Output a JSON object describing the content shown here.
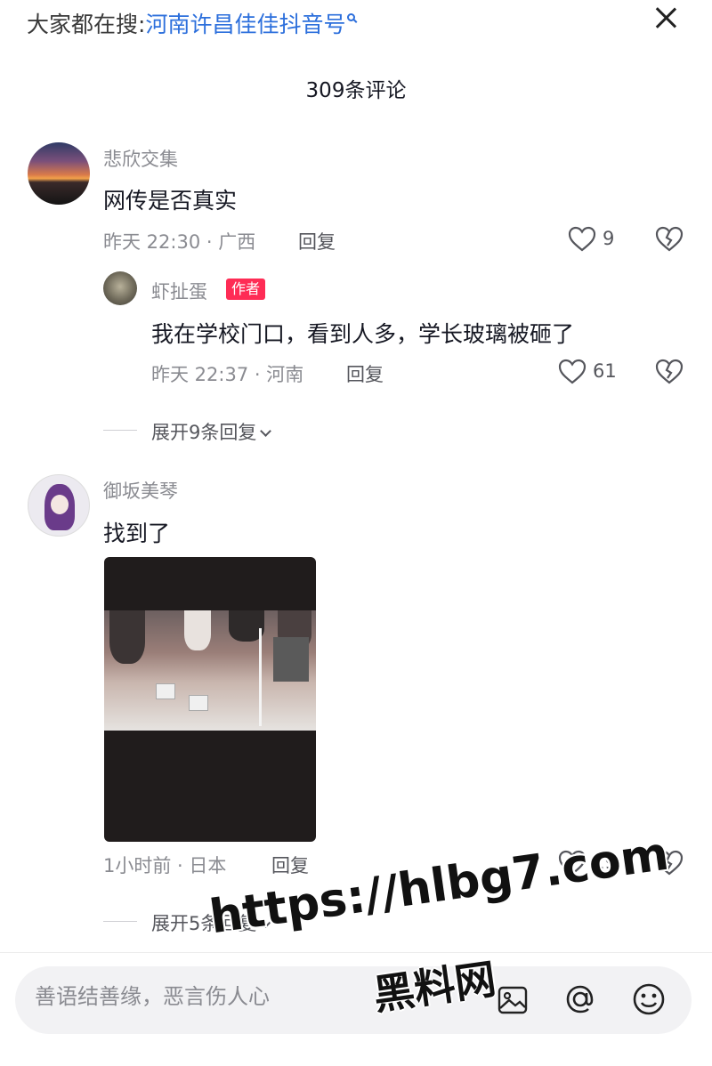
{
  "header": {
    "search_prefix": "大家都在搜:",
    "search_term": "河南许昌佳佳抖音号",
    "comment_count_title": "309条评论"
  },
  "comments": [
    {
      "username": "悲欣交集",
      "text": "网传是否真实",
      "meta": "昨天 22:30 · 广西",
      "reply_label": "回复",
      "likes": "9",
      "replies": [
        {
          "username": "虾扯蛋",
          "badge": "作者",
          "text": "我在学校门口，看到人多，学长玻璃被砸了",
          "meta": "昨天 22:37 · 河南",
          "reply_label": "回复",
          "likes": "61"
        }
      ],
      "expand_label": "展开9条回复"
    },
    {
      "username": "御坂美琴",
      "text": "找到了",
      "meta": "1小时前 · 日本",
      "reply_label": "回复",
      "likes": "19",
      "expand_label": "展开5条回复"
    }
  ],
  "composer": {
    "placeholder": "善语结善缘，恶言伤人心"
  },
  "watermark": {
    "url": "https://hlbg7.com",
    "name": "黑料网"
  },
  "icons": {
    "close": "close-icon",
    "like": "heart-icon",
    "dislike": "broken-heart-icon",
    "image": "image-icon",
    "mention": "at-icon",
    "emoji": "emoji-icon"
  }
}
